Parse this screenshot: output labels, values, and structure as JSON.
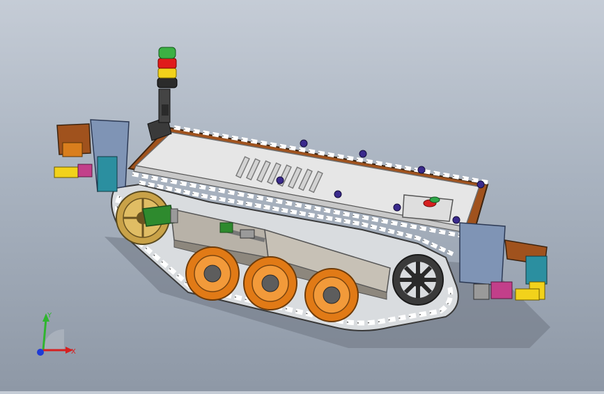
{
  "viewport": {
    "background_top": "#c5ccd6",
    "background_bottom": "#8e98a6"
  },
  "model": {
    "body_color": "#e6e6e6",
    "frame_color": "#a0521d",
    "wheel_color": "#f08a1e",
    "track_color": "#f2f2f2",
    "light_colors": [
      "#3cb043",
      "#e01b1b",
      "#f2d21b",
      "#2b2b2b"
    ],
    "button_colors": [
      "#d62020",
      "#2fa84a"
    ]
  },
  "triad": {
    "y_label": "Y",
    "x_label": "X",
    "y_color": "#2fb52f",
    "x_color": "#d62020",
    "z_color": "#1f3bd6"
  }
}
